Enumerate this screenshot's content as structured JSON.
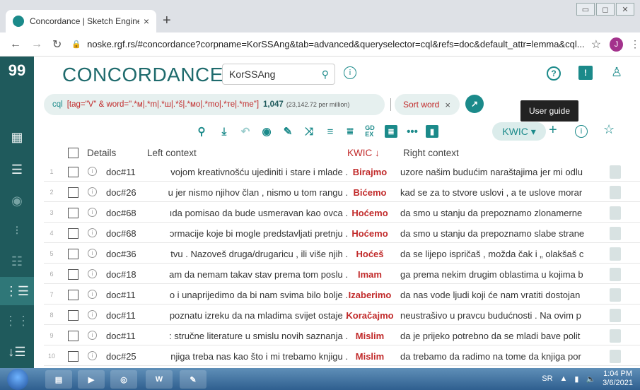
{
  "browser": {
    "tab_title": "Concordance | Sketch Engine",
    "tab_close": "×",
    "new_tab": "+",
    "url": "noske.rgf.rs/#concordance?corpname=KorSSAng&tab=advanced&queryselector=cql&refs=doc&default_attr=lemma&cql...",
    "profile_initial": "J"
  },
  "header": {
    "title": "CONCORDANCE",
    "corpus": "KorSSAng"
  },
  "query": {
    "label": "cql",
    "value": "[tag=\"V\" & word=\".*м|.*m|.*ш|.*š|.*мо|.*mo|.*те|.*me\"]",
    "count": "1,047",
    "per_million": "(23,142.72 per million)",
    "sort_label": "Sort word",
    "sort_close": "×",
    "tooltip": "User guide"
  },
  "toolbar": {
    "view_mode": "KWIC ▾"
  },
  "table": {
    "headers": {
      "details": "Details",
      "left": "Left context",
      "kwic": "KWIC ↓",
      "right": "Right context"
    },
    "rows": [
      {
        "n": "1",
        "doc": "doc#11",
        "left": "vojom kreativnošću ujediniti i stare i mlade .",
        "kwic": "Birajmo",
        "right": "uzore našim budućim naraštajima jer mi odlu"
      },
      {
        "n": "2",
        "doc": "doc#26",
        "left": "u jer nismo njihov član , nismo u tom rangu .",
        "kwic": "Bićemo",
        "right": "kad se za to stvore uslovi , a te uslove morar"
      },
      {
        "n": "3",
        "doc": "doc#68",
        "left": "ıda pomisao da bude usmeravan kao ovca .",
        "kwic": "Hoćemo",
        "right": "da smo u stanju da prepoznamo zlonamerne"
      },
      {
        "n": "4",
        "doc": "doc#68",
        "left": "ɔrmacije koje bi mogle predstavljati pretnju .",
        "kwic": "Hoćemo",
        "right": "da smo u stanju da prepoznamo slabe strane"
      },
      {
        "n": "5",
        "doc": "doc#36",
        "left": "tvu . Nazoveš druga/drugaricu , ili više njih .",
        "kwic": "Hoćeš",
        "right": "da se lijepo ispričaš , možda čak i „ olakšaš c"
      },
      {
        "n": "6",
        "doc": "doc#18",
        "left": "am da nemam takav stav prema tom poslu .",
        "kwic": "Imam",
        "right": "ga prema nekim drugim oblastima u kojima b"
      },
      {
        "n": "7",
        "doc": "doc#11",
        "left": "o i unaprijedimo da bi nam svima bilo bolje .",
        "kwic": "Izaberimo",
        "right": "da nas vode ljudi koji će nam vratiti dostojan"
      },
      {
        "n": "8",
        "doc": "doc#11",
        "left": "poznatu izreku da na mladima svijet ostaje .",
        "kwic": "Koračajmo",
        "right": "neustrašivo u pravcu budućnosti . Na ovim p"
      },
      {
        "n": "9",
        "doc": "doc#11",
        "left": ": stručne literature u smislu novih saznanja .",
        "kwic": "Mislim",
        "right": "da je prijeko potrebno da se mladi bave polit"
      },
      {
        "n": "10",
        "doc": "doc#25",
        "left": "njiga treba nas kao što i mi trebamo knjigu .",
        "kwic": "Mislim",
        "right": "da trebamo da radimo na tome da knjiga por"
      }
    ]
  },
  "taskbar": {
    "lang": "SR",
    "time": "1:04 PM",
    "date": "3/6/2021"
  }
}
